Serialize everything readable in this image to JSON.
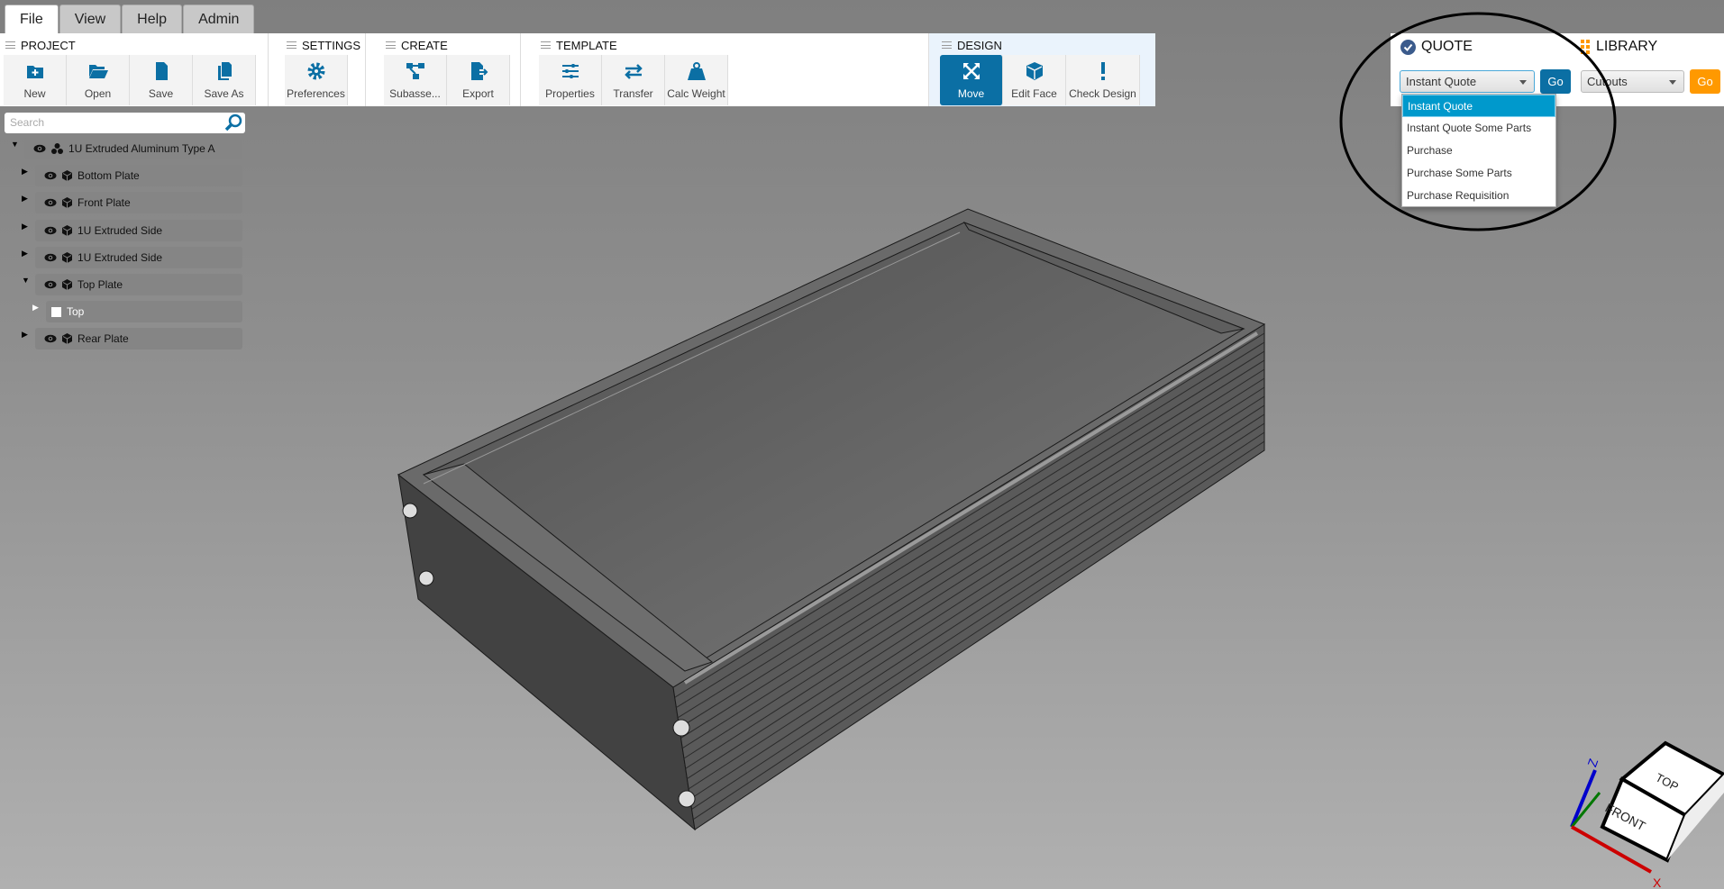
{
  "tabs": [
    {
      "label": "File",
      "active": true
    },
    {
      "label": "View"
    },
    {
      "label": "Help"
    },
    {
      "label": "Admin"
    }
  ],
  "ribbon": {
    "project": {
      "title": "PROJECT",
      "buttons": [
        "New",
        "Open",
        "Save",
        "Save As"
      ]
    },
    "settings": {
      "title": "SETTINGS",
      "buttons": [
        "Preferences"
      ]
    },
    "create": {
      "title": "CREATE",
      "buttons": [
        "Subasse...",
        "Export"
      ]
    },
    "template": {
      "title": "TEMPLATE",
      "buttons": [
        "Properties",
        "Transfer",
        "Calc Weight"
      ]
    },
    "design": {
      "title": "DESIGN",
      "buttons": [
        "Move",
        "Edit Face",
        "Check Design"
      ]
    }
  },
  "quote": {
    "title": "QUOTE",
    "selected": "Instant Quote",
    "go": "Go",
    "options": [
      "Instant Quote",
      "Instant Quote Some Parts",
      "Purchase",
      "Purchase Some Parts",
      "Purchase Requisition"
    ]
  },
  "library": {
    "title": "LIBRARY",
    "selected": "Cutouts",
    "go": "Go"
  },
  "search": {
    "placeholder": "Search"
  },
  "tree": [
    {
      "label": "1U Extruded Aluminum Type A",
      "expanded": true,
      "icon": "assembly-icon"
    },
    {
      "label": "Bottom Plate",
      "icon": "part-icon"
    },
    {
      "label": "Front Plate",
      "icon": "part-icon"
    },
    {
      "label": "1U Extruded Side",
      "icon": "part-icon"
    },
    {
      "label": "1U Extruded Side",
      "icon": "part-icon"
    },
    {
      "label": "Top Plate",
      "expanded": true,
      "icon": "part-icon"
    },
    {
      "label": "Top",
      "icon": "checkbox"
    },
    {
      "label": "Rear Plate",
      "icon": "part-icon"
    }
  ],
  "navcube": {
    "top": "TOP",
    "front": "FRONT",
    "x": "X",
    "z": "Z"
  },
  "colors": {
    "accent": "#0b6fa4",
    "library_go": "#ff9900",
    "highlight": "#0099cc"
  }
}
